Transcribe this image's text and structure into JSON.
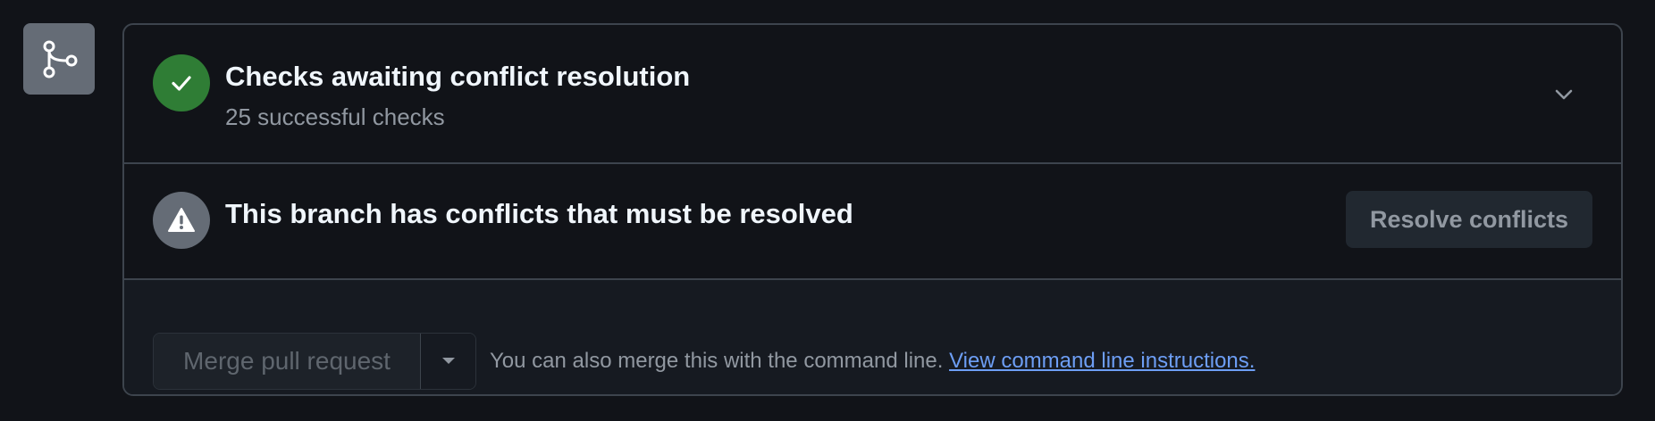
{
  "sidebar": {
    "icon": "git-merge-icon"
  },
  "checks": {
    "icon": "check-icon",
    "title": "Checks awaiting conflict resolution",
    "subtitle": "25 successful checks",
    "expand_icon": "chevron-down-icon",
    "status_color": "#2f7d35"
  },
  "conflict": {
    "icon": "alert-icon",
    "title": "This branch has conflicts that must be resolved",
    "resolve_label": "Resolve conflicts"
  },
  "merge": {
    "button_label": "Merge pull request",
    "dropdown_icon": "caret-down-icon",
    "text": "You can also merge this with the command line.",
    "link_text": "View command line instructions.",
    "link_color": "#6d9ef5"
  }
}
